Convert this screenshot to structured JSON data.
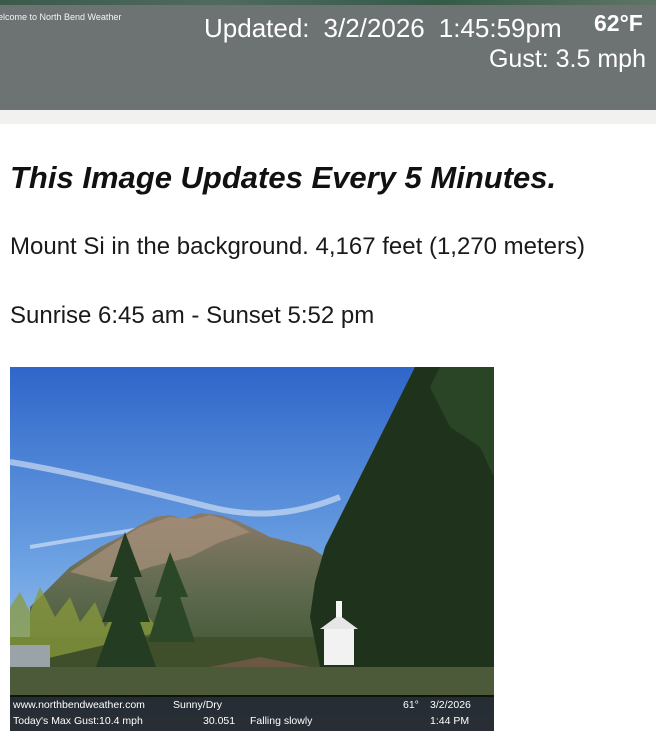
{
  "header": {
    "welcome": "elcome to North Bend Weather",
    "updated_label": "Updated:",
    "updated_date": "3/2/2026",
    "updated_time": "1:45:59pm",
    "temperature": "62°F",
    "gust": "Gust: 3.5 mph"
  },
  "main": {
    "heading": "This Image Updates Every 5 Minutes.",
    "mount_info": "Mount Si in the background. 4,167 feet (1,270 meters)",
    "sun_times": "Sunrise 6:45 am - Sunset 5:52 pm"
  },
  "webcam": {
    "site": "www.northbendweather.com",
    "condition": "Sunny/Dry",
    "temp": "61°",
    "date": "3/2/2026",
    "max_gust": "Today's Max Gust:10.4 mph",
    "pressure": "30.051",
    "pressure_trend": "Falling slowly",
    "time": "1:44 PM"
  },
  "colors": {
    "header_bg": "#6d7373",
    "page_bg": "#ffffff",
    "text": "#111111"
  }
}
